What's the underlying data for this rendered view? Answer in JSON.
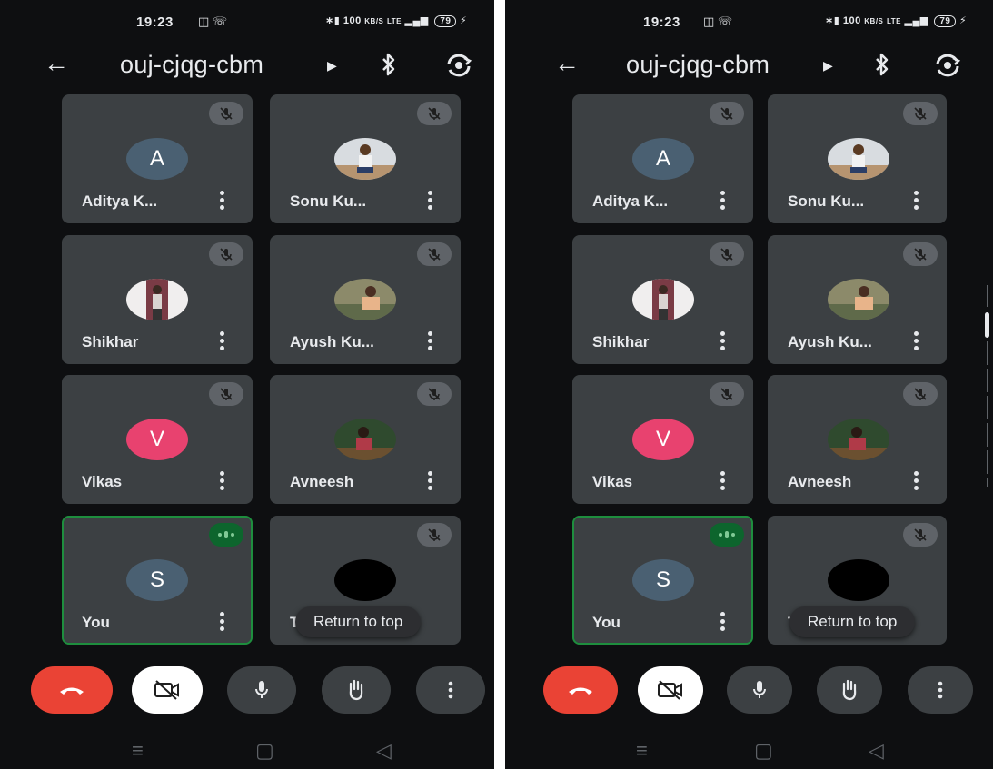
{
  "status": {
    "time": "19:23",
    "net_speed": "100",
    "net_unit": "KB/S",
    "lte": "LTE",
    "battery": "79"
  },
  "meeting": {
    "code": "ouj-cjqg-cbm"
  },
  "participants": [
    {
      "name": "Aditya K...",
      "initial": "A",
      "avatar_color": "#4a6072",
      "muted": true
    },
    {
      "name": "Sonu Ku...",
      "initial": "",
      "avatar_color": "",
      "muted": true
    },
    {
      "name": "Shikhar",
      "initial": "",
      "avatar_color": "",
      "muted": true
    },
    {
      "name": "Ayush Ku...",
      "initial": "",
      "avatar_color": "",
      "muted": true
    },
    {
      "name": "Vikas",
      "initial": "V",
      "avatar_color": "#e8426f",
      "muted": true
    },
    {
      "name": "Avneesh",
      "initial": "",
      "avatar_color": "",
      "muted": true
    },
    {
      "name": "You",
      "initial": "S",
      "avatar_color": "#4a6072",
      "muted": false,
      "speaking": true
    },
    {
      "name": "Ta",
      "initial": "",
      "avatar_color": "#000000",
      "muted": true
    }
  ],
  "return_to_top_label": "Return to top",
  "colors": {
    "hangup": "#ea4335",
    "tile": "#3c4043",
    "background": "#0e0f11",
    "speaking": "#1e8e3e"
  },
  "icons": [
    "back-arrow-icon",
    "bluetooth-icon",
    "switch-camera-icon",
    "mic-off-icon",
    "speaking-icon",
    "more-vert-icon",
    "hangup-icon",
    "video-off-icon",
    "mic-icon",
    "raise-hand-icon"
  ]
}
